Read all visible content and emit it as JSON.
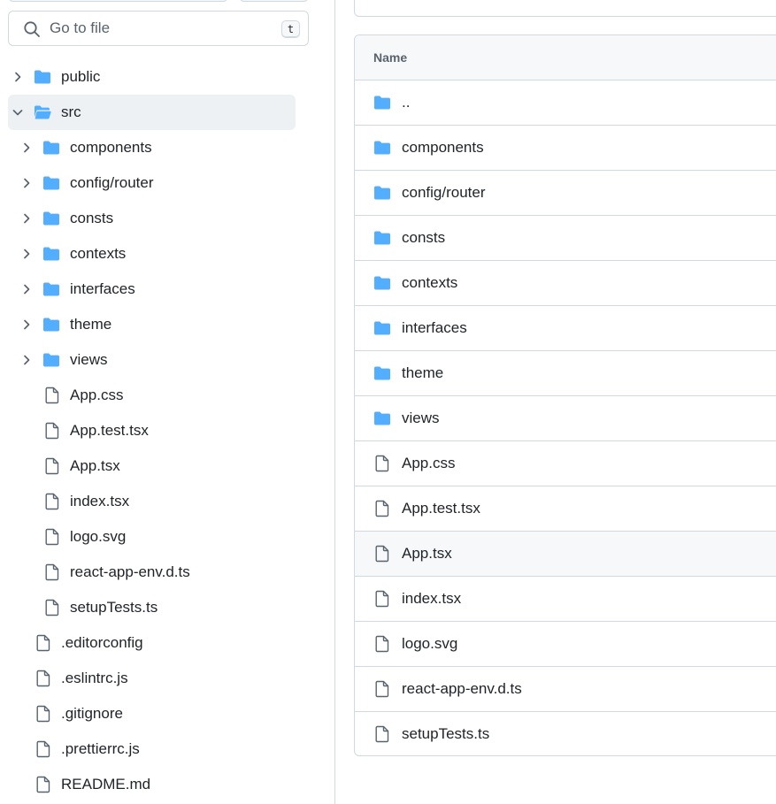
{
  "search": {
    "placeholder": "Go to file",
    "shortcut": "t"
  },
  "tree": [
    {
      "label": "public",
      "type": "folder",
      "depth": 0,
      "chevron": "right"
    },
    {
      "label": "src",
      "type": "folder-open",
      "depth": 0,
      "chevron": "down",
      "selected": true
    },
    {
      "label": "components",
      "type": "folder",
      "depth": 1,
      "chevron": "right"
    },
    {
      "label": "config/router",
      "type": "folder",
      "depth": 1,
      "chevron": "right"
    },
    {
      "label": "consts",
      "type": "folder",
      "depth": 1,
      "chevron": "right"
    },
    {
      "label": "contexts",
      "type": "folder",
      "depth": 1,
      "chevron": "right"
    },
    {
      "label": "interfaces",
      "type": "folder",
      "depth": 1,
      "chevron": "right"
    },
    {
      "label": "theme",
      "type": "folder",
      "depth": 1,
      "chevron": "right"
    },
    {
      "label": "views",
      "type": "folder",
      "depth": 1,
      "chevron": "right"
    },
    {
      "label": "App.css",
      "type": "file",
      "depth": 1
    },
    {
      "label": "App.test.tsx",
      "type": "file",
      "depth": 1
    },
    {
      "label": "App.tsx",
      "type": "file",
      "depth": 1
    },
    {
      "label": "index.tsx",
      "type": "file",
      "depth": 1
    },
    {
      "label": "logo.svg",
      "type": "file",
      "depth": 1
    },
    {
      "label": "react-app-env.d.ts",
      "type": "file",
      "depth": 1
    },
    {
      "label": "setupTests.ts",
      "type": "file",
      "depth": 1
    },
    {
      "label": ".editorconfig",
      "type": "file",
      "depth": 0
    },
    {
      "label": ".eslintrc.js",
      "type": "file",
      "depth": 0
    },
    {
      "label": ".gitignore",
      "type": "file",
      "depth": 0
    },
    {
      "label": ".prettierrc.js",
      "type": "file",
      "depth": 0
    },
    {
      "label": "README.md",
      "type": "file",
      "depth": 0
    }
  ],
  "table": {
    "header": "Name",
    "rows": [
      {
        "label": "..",
        "type": "folder"
      },
      {
        "label": "components",
        "type": "folder"
      },
      {
        "label": "config/router",
        "type": "folder"
      },
      {
        "label": "consts",
        "type": "folder"
      },
      {
        "label": "contexts",
        "type": "folder"
      },
      {
        "label": "interfaces",
        "type": "folder"
      },
      {
        "label": "theme",
        "type": "folder"
      },
      {
        "label": "views",
        "type": "folder"
      },
      {
        "label": "App.css",
        "type": "file"
      },
      {
        "label": "App.test.tsx",
        "type": "file"
      },
      {
        "label": "App.tsx",
        "type": "file",
        "hover": true
      },
      {
        "label": "index.tsx",
        "type": "file"
      },
      {
        "label": "logo.svg",
        "type": "file"
      },
      {
        "label": "react-app-env.d.ts",
        "type": "file"
      },
      {
        "label": "setupTests.ts",
        "type": "file"
      }
    ]
  },
  "colors": {
    "folder": "#54aeff",
    "file_icon": "#59636e",
    "border": "#d1d9e0",
    "selected_bg": "#eef1f4"
  }
}
